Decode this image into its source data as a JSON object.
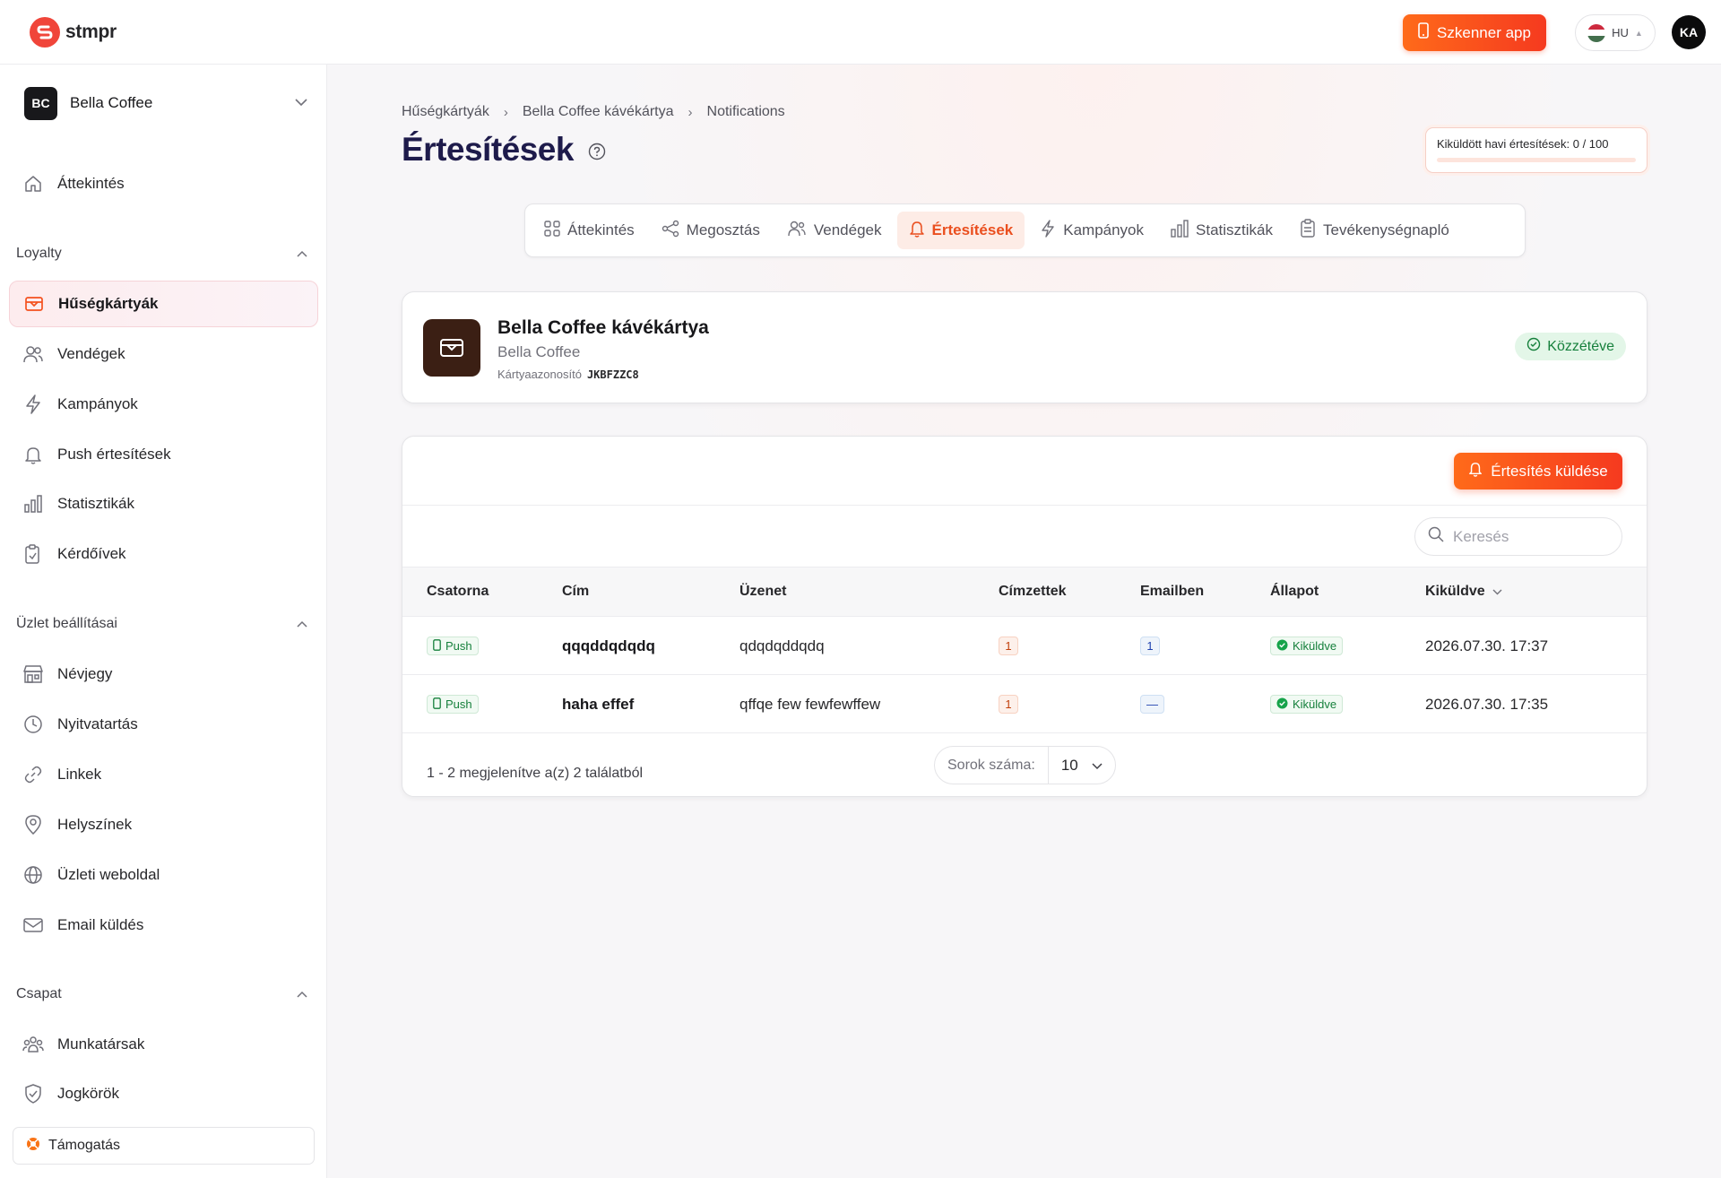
{
  "app": {
    "logo_text": "stmpr",
    "brand_color": "#f0453a"
  },
  "topbar": {
    "scanner_button": "Szkenner app",
    "language": "HU",
    "user_initials": "KA"
  },
  "sidebar": {
    "business": {
      "initials": "BC",
      "name": "Bella Coffee"
    },
    "overview": "Áttekintés",
    "sections": [
      {
        "title": "Loyalty",
        "items": [
          {
            "label": "Hűségkártyák",
            "icon": "card-icon",
            "active": true
          },
          {
            "label": "Vendégek",
            "icon": "users-icon"
          },
          {
            "label": "Kampányok",
            "icon": "bolt-icon"
          },
          {
            "label": "Push értesítések",
            "icon": "bell-icon"
          },
          {
            "label": "Statisztikák",
            "icon": "chart-icon"
          },
          {
            "label": "Kérdőívek",
            "icon": "clipboard-icon"
          }
        ]
      },
      {
        "title": "Üzlet beállításai",
        "items": [
          {
            "label": "Névjegy",
            "icon": "store-icon"
          },
          {
            "label": "Nyitvatartás",
            "icon": "clock-icon"
          },
          {
            "label": "Linkek",
            "icon": "link-icon"
          },
          {
            "label": "Helyszínek",
            "icon": "pin-icon"
          },
          {
            "label": "Üzleti weboldal",
            "icon": "globe-icon"
          },
          {
            "label": "Email küldés",
            "icon": "mail-icon"
          }
        ]
      },
      {
        "title": "Csapat",
        "items": [
          {
            "label": "Munkatársak",
            "icon": "team-icon"
          },
          {
            "label": "Jogkörök",
            "icon": "shield-icon"
          }
        ]
      }
    ],
    "support": "Támogatás"
  },
  "breadcrumb": [
    "Hűségkártyák",
    "Bella Coffee kávékártya",
    "Notifications"
  ],
  "page": {
    "title": "Értesítések",
    "quota_label": "Kiküldött havi értesítések: 0 / 100",
    "quota_fraction": 0.0
  },
  "tabs": [
    {
      "label": "Áttekintés",
      "icon": "grid-icon"
    },
    {
      "label": "Megosztás",
      "icon": "share-icon"
    },
    {
      "label": "Vendégek",
      "icon": "users-icon"
    },
    {
      "label": "Értesítések",
      "icon": "bell-icon",
      "active": true
    },
    {
      "label": "Kampányok",
      "icon": "bolt-icon"
    },
    {
      "label": "Statisztikák",
      "icon": "chart-icon"
    },
    {
      "label": "Tevékenységnapló",
      "icon": "clipboard-icon"
    }
  ],
  "card": {
    "name": "Bella Coffee kávékártya",
    "business": "Bella Coffee",
    "id_label": "Kártyaazonosító",
    "id_value": "JKBFZZC8",
    "status": "Közzétéve"
  },
  "table": {
    "send_button": "Értesítés küldése",
    "search_placeholder": "Keresés",
    "columns": [
      "Csatorna",
      "Cím",
      "Üzenet",
      "Címzettek",
      "Emailben",
      "Állapot",
      "Kiküldve"
    ],
    "rows": [
      {
        "channel": "Push",
        "title": "qqqddqdqdq",
        "message": "qdqdqddqdq",
        "recipients": "1",
        "email": "1",
        "status": "Kiküldve",
        "sent": "2026.07.30. 17:37"
      },
      {
        "channel": "Push",
        "title": "haha effef",
        "message": "qffqe few fewfewffew",
        "recipients": "1",
        "email": "—",
        "status": "Kiküldve",
        "sent": "2026.07.30. 17:35"
      }
    ],
    "footer": "1 - 2 megjelenítve a(z) 2 találatból",
    "rows_label": "Sorok száma:",
    "rows_value": "10"
  }
}
